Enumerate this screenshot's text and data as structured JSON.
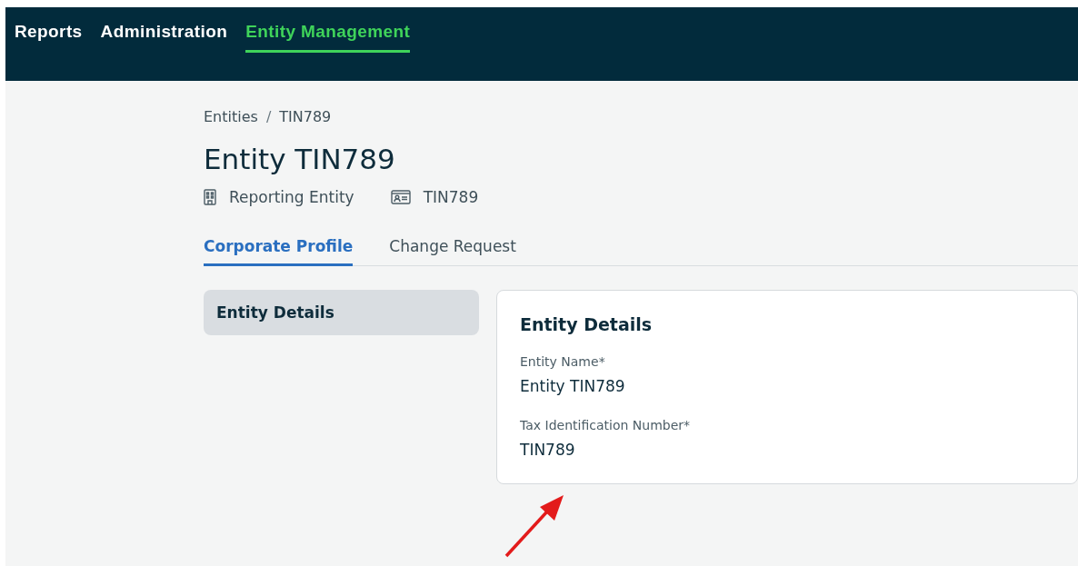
{
  "nav": {
    "items": [
      {
        "label": "Reports",
        "selected": false
      },
      {
        "label": "Administration",
        "selected": false
      },
      {
        "label": "Entity Management",
        "selected": true
      }
    ]
  },
  "breadcrumb": [
    "Entities",
    "TIN789"
  ],
  "breadcrumb_separator": "/",
  "title": "Entity TIN789",
  "meta": [
    {
      "kind": "building",
      "text": "Reporting Entity"
    },
    {
      "kind": "id-card",
      "text": "TIN789"
    }
  ],
  "tabs": [
    {
      "label": "Corporate Profile",
      "selected": true
    },
    {
      "label": "Change Request",
      "selected": false
    }
  ],
  "sidebar": {
    "items": [
      {
        "label": "Entity Details",
        "selected": true
      }
    ]
  },
  "card": {
    "title": "Entity Details",
    "fields": [
      {
        "label": "Entity Name*",
        "value": "Entity TIN789"
      },
      {
        "label": "Tax Identification Number*",
        "value": "TIN789"
      }
    ]
  },
  "annotation": {
    "kind": "arrow"
  }
}
